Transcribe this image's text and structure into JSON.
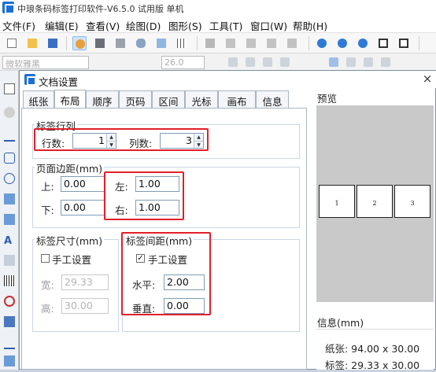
{
  "app": {
    "title": "中琅条码标签打印软件-V6.5.0 试用版 单机"
  },
  "menu": [
    "文件(F)",
    "编辑(E)",
    "查看(V)",
    "绘图(D)",
    "图形(S)",
    "工具(T)",
    "窗口(W)",
    "帮助(H)"
  ],
  "formatbar": {
    "font_name": "微软雅黑",
    "font_size": "26.0"
  },
  "dialog": {
    "title": "文档设置",
    "close": "×",
    "tabs": [
      "纸张",
      "布局",
      "顺序",
      "页码",
      "区间",
      "光标",
      "画布",
      "信息"
    ],
    "active_tab": "布局",
    "rows_cols": {
      "title": "标签行列",
      "rows_label": "行数:",
      "rows_value": "1",
      "cols_label": "列数:",
      "cols_value": "3"
    },
    "margins": {
      "title": "页面边距(mm)",
      "top_label": "上:",
      "top_value": "0.00",
      "bottom_label": "下:",
      "bottom_value": "0.00",
      "left_label": "左:",
      "left_value": "1.00",
      "right_label": "右:",
      "right_value": "1.00"
    },
    "label_size": {
      "title": "标签尺寸(mm)",
      "manual_label": "手工设置",
      "manual_checked": false,
      "width_label": "宽:",
      "width_value": "29.33",
      "height_label": "高:",
      "height_value": "30.00"
    },
    "label_spacing": {
      "title": "标签间距(mm)",
      "manual_label": "手工设置",
      "manual_checked": true,
      "horizontal_label": "水平:",
      "horizontal_value": "2.00",
      "vertical_label": "垂直:",
      "vertical_value": "0.00"
    },
    "preview": {
      "title": "预览",
      "labels": [
        "1",
        "2",
        "3"
      ]
    },
    "info": {
      "title": "信息(mm)",
      "paper": "纸张: 94.00 x 30.00",
      "label": "标签: 29.33 x 30.00"
    }
  },
  "colors": {
    "highlight": "#e0202a",
    "accent": "#1c6fd6",
    "preview_bg": "#c9c9c9"
  }
}
